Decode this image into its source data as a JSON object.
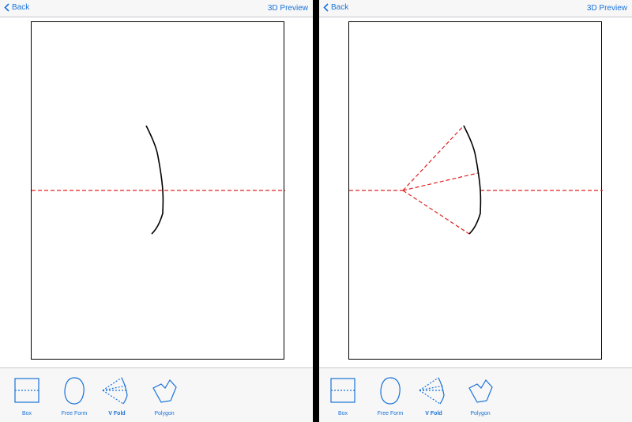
{
  "nav": {
    "back_label": "Back",
    "preview_label": "3D Preview"
  },
  "tools": [
    {
      "label": "Box",
      "icon": "box-fold-icon"
    },
    {
      "label": "Free Form",
      "icon": "free-form-icon"
    },
    {
      "label": "V Fold",
      "icon": "v-fold-icon",
      "selected": true
    },
    {
      "label": "Polygon",
      "icon": "polygon-icon"
    }
  ],
  "colors": {
    "accent": "#1a73d9",
    "fold_line": "#e02020",
    "stroke": "#000000"
  }
}
